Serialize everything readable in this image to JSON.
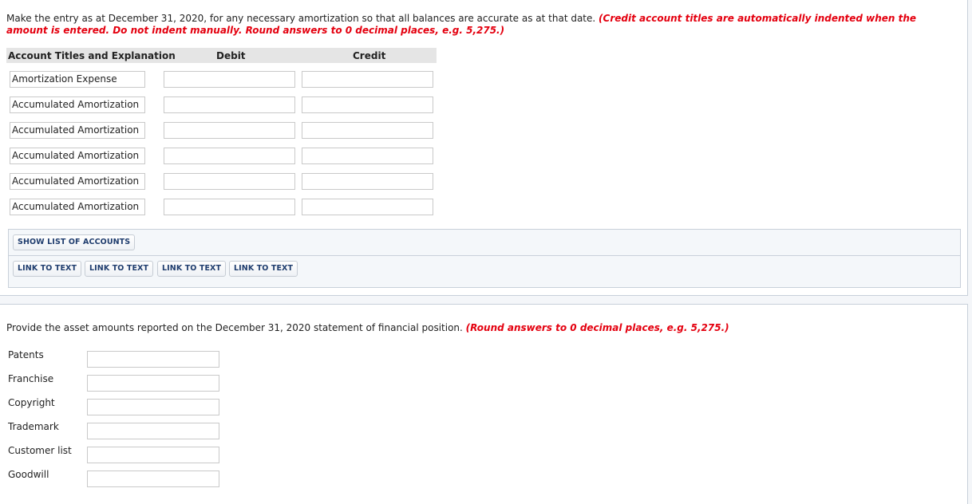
{
  "part1": {
    "instruction": "Make the entry as at December 31, 2020, for any necessary amortization so that all balances are accurate as at that date.",
    "instruction_note": "(Credit account titles are automatically indented when the amount is entered. Do not indent manually. Round answers to 0 decimal places, e.g. 5,275.)",
    "table_headers": {
      "account": "Account Titles and Explanation",
      "debit": "Debit",
      "credit": "Credit"
    },
    "rows": [
      {
        "account": "Amortization Expense",
        "debit": "",
        "credit": ""
      },
      {
        "account": "Accumulated Amortization",
        "debit": "",
        "credit": ""
      },
      {
        "account": "Accumulated Amortization",
        "debit": "",
        "credit": ""
      },
      {
        "account": "Accumulated Amortization",
        "debit": "",
        "credit": ""
      },
      {
        "account": "Accumulated Amortization",
        "debit": "",
        "credit": ""
      },
      {
        "account": "Accumulated Amortization",
        "debit": "",
        "credit": ""
      }
    ],
    "buttons": {
      "show_accounts": "SHOW LIST OF ACCOUNTS",
      "links": [
        "LINK TO TEXT",
        "LINK TO TEXT",
        "LINK TO TEXT",
        "LINK TO TEXT"
      ]
    }
  },
  "part2": {
    "instruction": "Provide the asset amounts reported on the December 31, 2020 statement of financial position.",
    "instruction_note": "(Round answers to 0 decimal places, e.g. 5,275.)",
    "assets": [
      {
        "label": "Patents",
        "value": ""
      },
      {
        "label": "Franchise",
        "value": ""
      },
      {
        "label": "Copyright",
        "value": ""
      },
      {
        "label": "Trademark",
        "value": ""
      },
      {
        "label": "Customer list",
        "value": ""
      },
      {
        "label": "Goodwill",
        "value": ""
      }
    ]
  },
  "colors": {
    "accent_red": "#e4000f",
    "button_text": "#1f3d6e"
  }
}
